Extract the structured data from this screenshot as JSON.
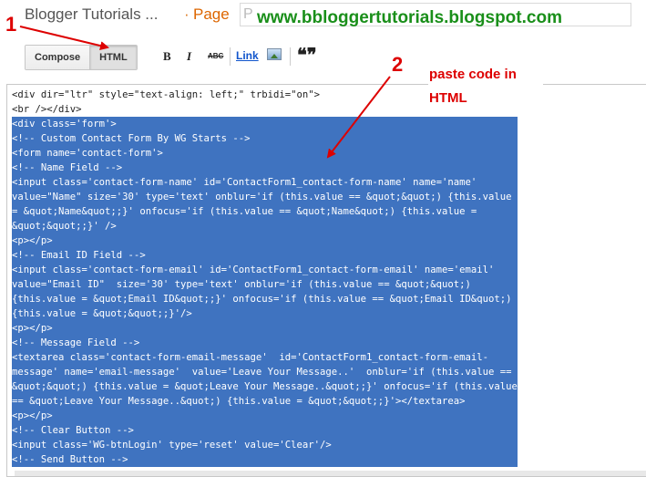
{
  "header": {
    "blog_title": "Blogger Tutorials ...",
    "separator": "·",
    "page_label": "Page",
    "title_input_value": "P",
    "site_url": "www.bbloggertutorials.blogspot.com"
  },
  "toolbar": {
    "compose_label": "Compose",
    "html_label": "HTML",
    "bold_label": "B",
    "italic_label": "I",
    "strike_label": "ABC",
    "link_label": "Link",
    "quote_label": "❝❞"
  },
  "annotations": {
    "step1": "1",
    "step2": "2",
    "note_line1": "paste  code in",
    "note_line2": "HTML"
  },
  "code_lines": [
    "<div dir=\"ltr\" style=\"text-align: left;\" trbidi=\"on\">",
    "<br /></div>",
    "<div class='form'>",
    "<!-- Custom Contact Form By WG Starts -->",
    "<form name='contact-form'>",
    "<!-- Name Field -->",
    "<input class='contact-form-name' id='ContactForm1_contact-form-name' name='name'",
    "value=\"Name\" size='30' type='text' onblur='if (this.value == &quot;&quot;) {this.value",
    "= &quot;Name&quot;;}' onfocus='if (this.value == &quot;Name&quot;) {this.value =",
    "&quot;&quot;;}' />",
    "<p></p>",
    "<!-- Email ID Field -->",
    "<input class='contact-form-email' id='ContactForm1_contact-form-email' name='email'",
    "value=\"Email ID\"  size='30' type='text' onblur='if (this.value == &quot;&quot;)",
    "{this.value = &quot;Email ID&quot;;}' onfocus='if (this.value == &quot;Email ID&quot;)",
    "{this.value = &quot;&quot;;}'/>",
    "<p></p>",
    "<!-- Message Field -->",
    "<textarea class='contact-form-email-message'  id='ContactForm1_contact-form-email-",
    "message' name='email-message'  value='Leave Your Message..'  onblur='if (this.value ==",
    "&quot;&quot;) {this.value = &quot;Leave Your Message..&quot;;}' onfocus='if (this.value",
    "== &quot;Leave Your Message..&quot;) {this.value = &quot;&quot;;}'></textarea>",
    "<p></p>",
    "<!-- Clear Button -->",
    "<input class='WG-btnLogin' type='reset' value='Clear'/>",
    "<!-- Send Button -->"
  ],
  "colors": {
    "selection": "#3f73c0",
    "annotation_red": "#dd0000",
    "url_green": "#1a8f1a",
    "page_orange": "#dd6600"
  }
}
